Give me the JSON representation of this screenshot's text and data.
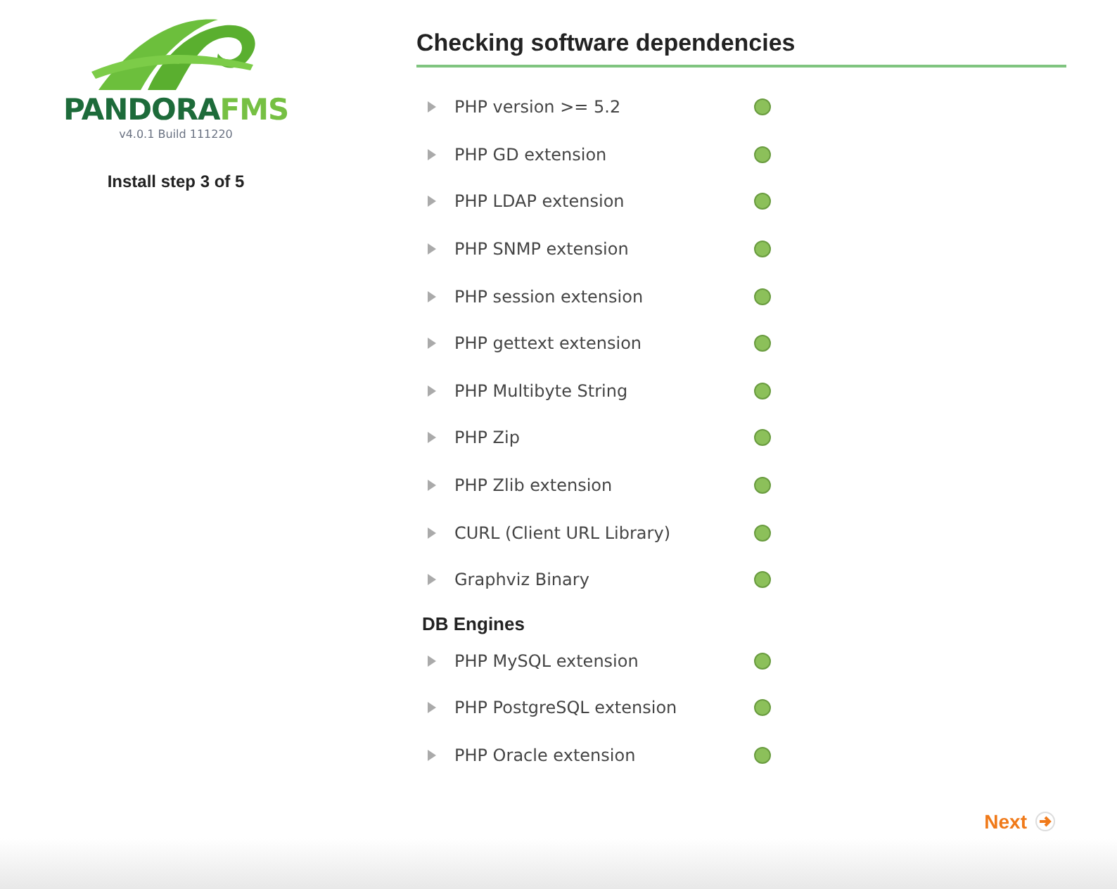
{
  "logo": {
    "name_part_1": "PANDORA",
    "name_part_2": "FMS",
    "version": "v4.0.1 Build 111220"
  },
  "install_step": "Install step 3 of 5",
  "title": "Checking software dependencies",
  "sections": [
    {
      "checks": [
        {
          "label": "PHP version >= 5.2",
          "passed": true
        },
        {
          "label": "PHP GD extension",
          "passed": true
        },
        {
          "label": "PHP LDAP extension",
          "passed": true
        },
        {
          "label": "PHP SNMP extension",
          "passed": true
        },
        {
          "label": "PHP session extension",
          "passed": true
        },
        {
          "label": "PHP gettext extension",
          "passed": true
        },
        {
          "label": "PHP Multibyte String",
          "passed": true
        },
        {
          "label": "PHP Zip",
          "passed": true
        },
        {
          "label": "PHP Zlib extension",
          "passed": true
        },
        {
          "label": "CURL (Client URL Library)",
          "passed": true
        },
        {
          "label": "Graphviz Binary",
          "passed": true
        }
      ]
    },
    {
      "heading": "DB Engines",
      "checks": [
        {
          "label": "PHP MySQL extension",
          "passed": true
        },
        {
          "label": "PHP PostgreSQL extension",
          "passed": true
        },
        {
          "label": "PHP Oracle extension",
          "passed": true
        }
      ]
    }
  ],
  "next_button": "Next"
}
